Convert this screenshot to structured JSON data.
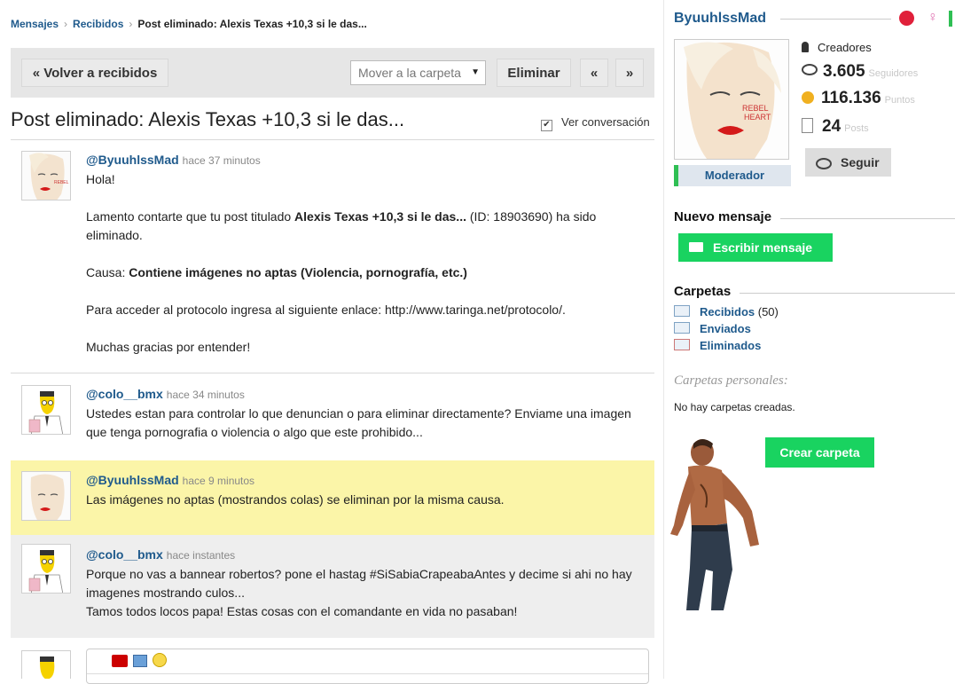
{
  "breadcrumb": {
    "mensajes": "Mensajes",
    "recibidos": "Recibidos",
    "current": "Post eliminado: Alexis Texas +10,3 si le das..."
  },
  "toolbar": {
    "back_label": "« Volver a recibidos",
    "move_placeholder": "Mover a la carpeta",
    "delete_label": "Eliminar",
    "prev_label": "«",
    "next_label": "»"
  },
  "conversation": {
    "title": "Post eliminado: Alexis Texas +10,3 si le das...",
    "view_conversation_label": "Ver conversación",
    "messages": [
      {
        "user": "@ByuuhlssMad",
        "time": "hace 37 minutos",
        "paragraphs": {
          "p1": "Hola!",
          "p2_prefix": "Lamento contarte que tu post titulado ",
          "p2_bold": "Alexis Texas +10,3 si le das...",
          "p2_suffix": " (ID: 18903690) ha sido eliminado.",
          "p3_prefix": "Causa: ",
          "p3_bold": "Contiene imágenes no aptas (Violencia, pornografía, etc.)",
          "p4": "Para acceder al protocolo ingresa al siguiente enlace: http://www.taringa.net/protocolo/.",
          "p5": "Muchas gracias por entender!"
        }
      },
      {
        "user": "@colo__bmx",
        "time": "hace 34 minutos",
        "text": "Ustedes estan para controlar lo que denuncian o para eliminar directamente? Enviame una imagen que tenga pornografia o violencia o algo que este prohibido..."
      },
      {
        "user": "@ByuuhlssMad",
        "time": "hace 9 minutos",
        "text": "Las imágenes no aptas (mostrandos colas) se eliminan por la misma causa."
      },
      {
        "user": "@colo__bmx",
        "time": "hace instantes",
        "text_line1": "Porque no vas a bannear robertos? pone el hastag #SiSabiaCrapeabaAntes y decime si ahi no hay imagenes mostrando culos...",
        "text_line2": "Tamos todos locos papa! Estas cosas con el comandante en vida no pasaban!"
      }
    ]
  },
  "profile": {
    "username": "ByuuhlssMad",
    "rank": "Creadores",
    "followers_value": "3.605",
    "followers_label": "Seguidores",
    "points_value": "116.136",
    "points_label": "Puntos",
    "posts_value": "24",
    "posts_label": "Posts",
    "follow_label": "Seguir",
    "role": "Moderador"
  },
  "new_message": {
    "title": "Nuevo mensaje",
    "button_label": "Escribir mensaje"
  },
  "folders": {
    "title": "Carpetas",
    "items": [
      {
        "name": "Recibidos",
        "count": "(50)"
      },
      {
        "name": "Enviados",
        "count": ""
      },
      {
        "name": "Eliminados",
        "count": ""
      }
    ],
    "personal_title": "Carpetas personales:",
    "empty_text": "No hay carpetas creadas.",
    "create_label": "Crear carpeta"
  },
  "colors": {
    "accent": "#1f5a8c",
    "green": "#19d360",
    "highlight": "#fbf5a8",
    "grey_row": "#eeeeee"
  }
}
